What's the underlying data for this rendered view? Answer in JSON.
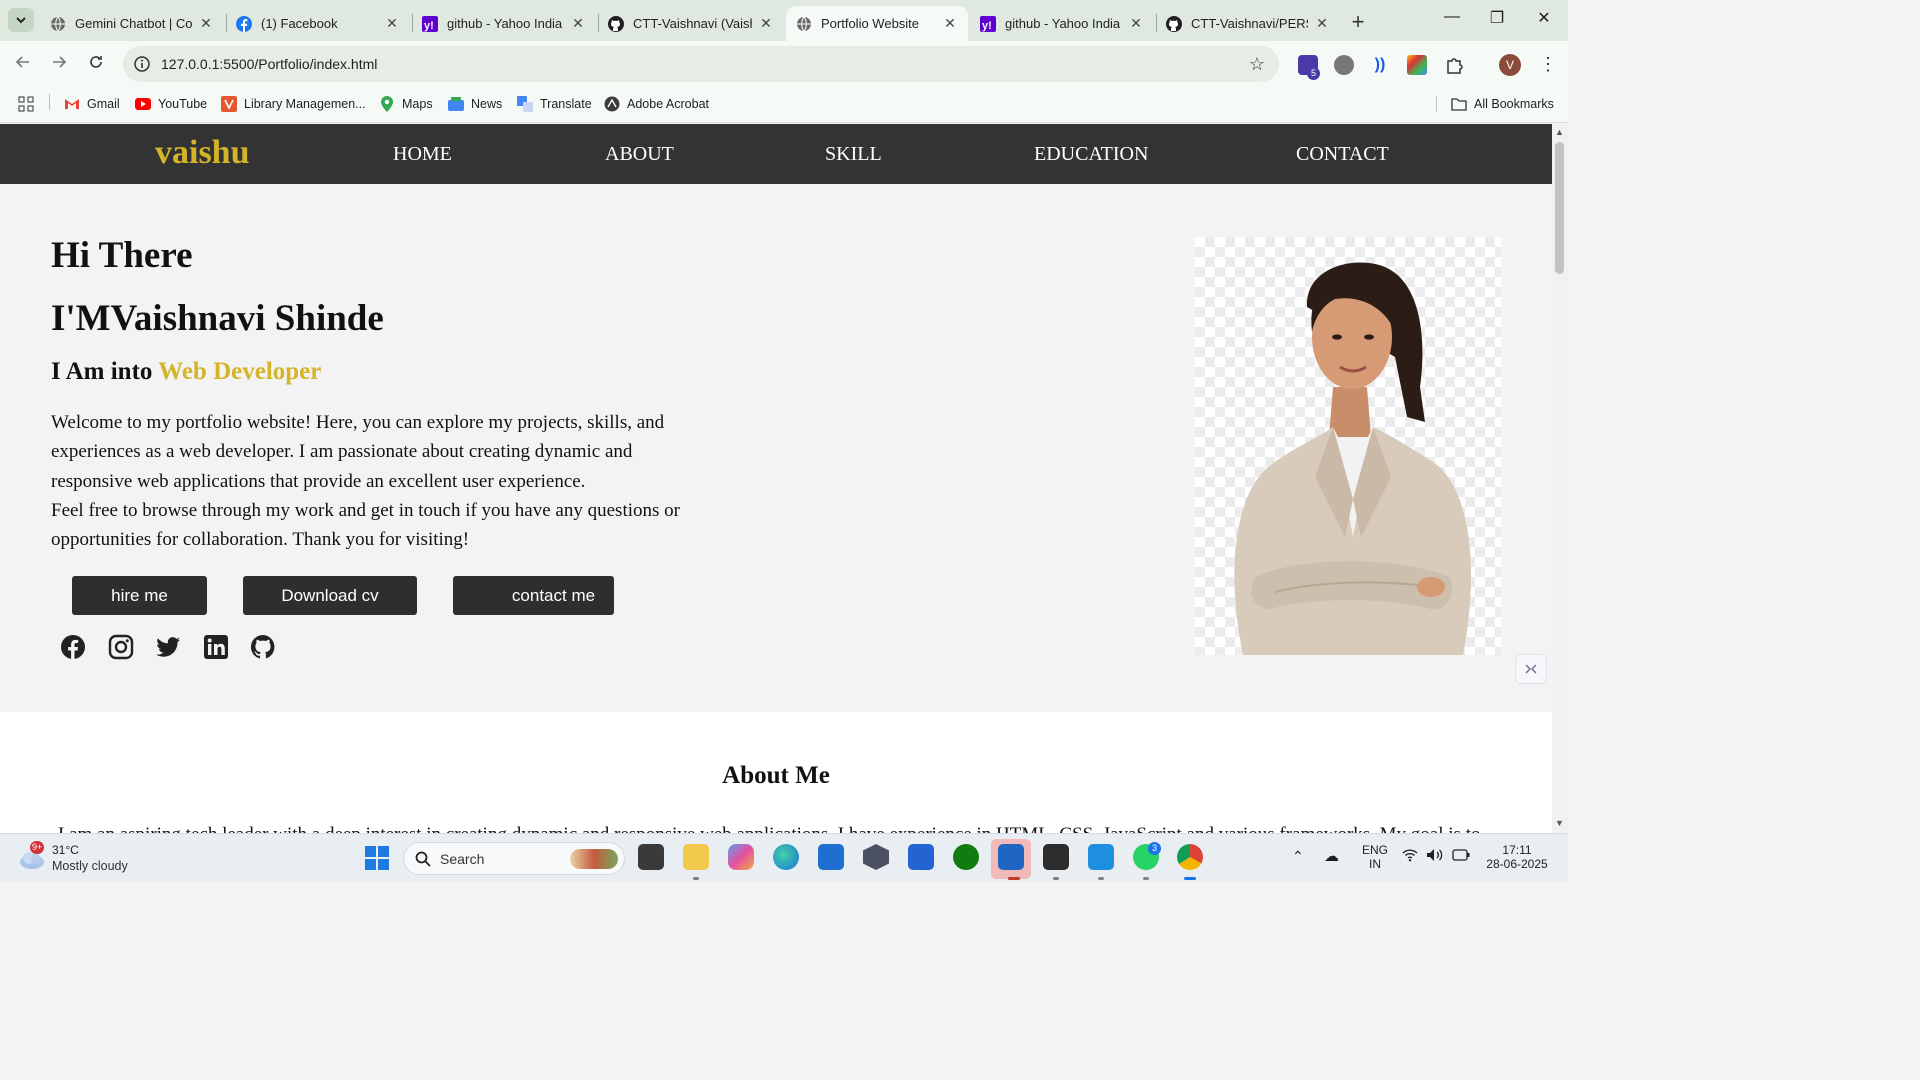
{
  "browser": {
    "tabs": [
      {
        "title": "Gemini Chatbot | Coc",
        "icon": "globe-icon",
        "active": false
      },
      {
        "title": "(1) Facebook",
        "icon": "facebook-icon",
        "active": false
      },
      {
        "title": "github - Yahoo India",
        "icon": "yahoo-icon",
        "active": false
      },
      {
        "title": "CTT-Vaishnavi (Vaish",
        "icon": "github-icon",
        "active": false
      },
      {
        "title": "Portfolio Website",
        "icon": "globe-icon",
        "active": true
      },
      {
        "title": "github - Yahoo India",
        "icon": "yahoo-icon",
        "active": false
      },
      {
        "title": "CTT-Vaishnavi/PERSC",
        "icon": "github-icon",
        "active": false
      }
    ],
    "url": "127.0.0.1:5500/Portfolio/index.html",
    "profile_initial": "V",
    "extension_badge": "5",
    "bookmarks": [
      {
        "label": "Gmail",
        "icon": "gmail-icon"
      },
      {
        "label": "YouTube",
        "icon": "youtube-icon"
      },
      {
        "label": "Library Managemen...",
        "icon": "library-icon"
      },
      {
        "label": "Maps",
        "icon": "maps-icon"
      },
      {
        "label": "News",
        "icon": "news-icon"
      },
      {
        "label": "Translate",
        "icon": "translate-icon"
      },
      {
        "label": "Adobe Acrobat",
        "icon": "acrobat-icon"
      }
    ],
    "all_bookmarks": "All Bookmarks"
  },
  "site": {
    "logo": "vaishu",
    "nav": [
      "HOME",
      "ABOUT",
      "SKILL",
      "EDUCATION",
      "CONTACT"
    ],
    "hero": {
      "greeting": "Hi There",
      "name_line": "I'MVaishnavi Shinde",
      "into_prefix": "I Am into ",
      "into_highlight": "Web Developer",
      "paragraph_1": "Welcome to my portfolio website! Here, you can explore my projects, skills, and experiences as a web developer. I am passionate about creating dynamic and responsive web applications that provide an excellent user experience.",
      "paragraph_2": "Feel free to browse through my work and get in touch if you have any questions or opportunities for collaboration. Thank you for visiting!",
      "buttons": [
        "hire me",
        "Download cv",
        "contact me"
      ],
      "socials": [
        "facebook-icon",
        "instagram-icon",
        "twitter-icon",
        "linkedin-icon",
        "github-icon"
      ]
    },
    "about": {
      "heading": "About Me",
      "text": "I am an aspiring tech leader with a deep interest in creating dynamic and responsive web applications. I have experience in HTML, CSS, JavaScript and various frameworks. My goal is to"
    },
    "colors": {
      "accent": "#d4b429",
      "nav_bg": "#333333",
      "button_bg": "#2e2e2e"
    }
  },
  "taskbar": {
    "weather_temp": "31°C",
    "weather_desc": "Mostly cloudy",
    "weather_badge": "9+",
    "search_label": "Search",
    "lang_line1": "ENG",
    "lang_line2": "IN",
    "time": "17:11",
    "date": "28-06-2025",
    "whatsapp_badge": "3"
  }
}
